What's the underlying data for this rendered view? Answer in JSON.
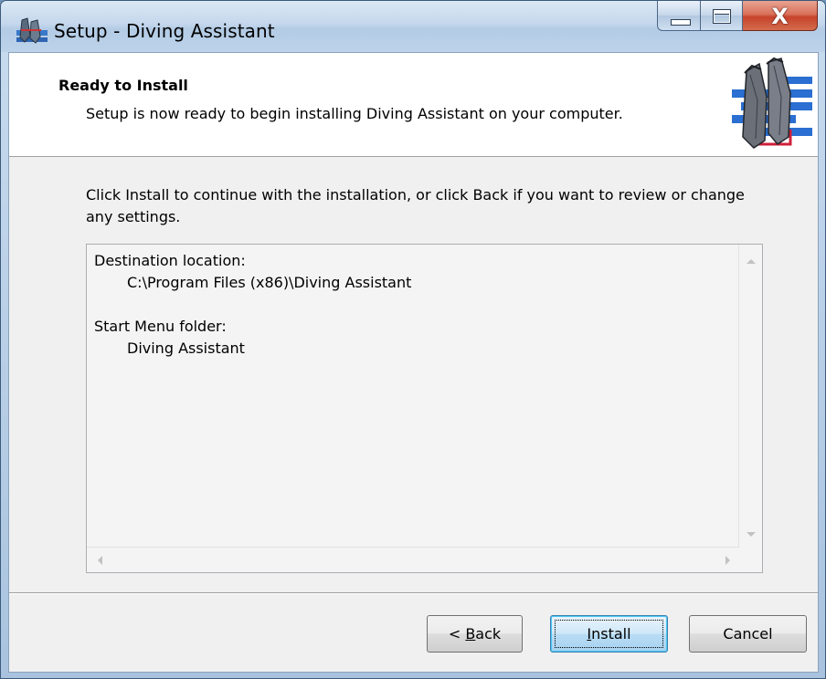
{
  "window": {
    "title": "Setup - Diving Assistant",
    "caption_buttons": [
      "minimize",
      "maximize",
      "close"
    ]
  },
  "header": {
    "title": "Ready to Install",
    "subtitle": "Setup is now ready to begin installing Diving Assistant on your computer."
  },
  "intro_text": "Click Install to continue with the installation, or click Back if you want to review or change any settings.",
  "summary": {
    "destination_label": "Destination location:",
    "destination_value": "C:\\Program Files (x86)\\Diving Assistant",
    "startmenu_label": "Start Menu folder:",
    "startmenu_value": "Diving Assistant"
  },
  "buttons": {
    "back_prefix": "< ",
    "back_accel": "B",
    "back_rest": "ack",
    "install_accel": "I",
    "install_rest": "nstall",
    "cancel": "Cancel"
  },
  "colors": {
    "title_bar": "#c4d7ec",
    "close_button": "#c7432b",
    "default_button_border": "#3c7fb1"
  },
  "icons": {
    "app": "diving-fins-icon",
    "header_image": "diving-fins-image"
  }
}
